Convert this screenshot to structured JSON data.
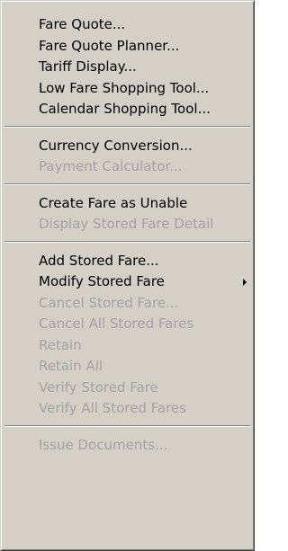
{
  "menu": {
    "group1": [
      "Fare Quote...",
      "Fare Quote Planner...",
      "Tariff Display...",
      "Low Fare Shopping Tool...",
      "Calendar Shopping Tool..."
    ],
    "group2": [
      "Currency Conversion...",
      "Payment Calculator..."
    ],
    "group3": [
      "Create Fare as Unable",
      "Display Stored Fare Detail"
    ],
    "group4": [
      "Add Stored Fare...",
      "Modify Stored Fare",
      "Cancel Stored Fare...",
      "Cancel All Stored Fares",
      "Retain",
      "Retain All",
      "Verify Stored Fare",
      "Verify All Stored Fares"
    ],
    "group5": [
      "Issue Documents..."
    ]
  }
}
